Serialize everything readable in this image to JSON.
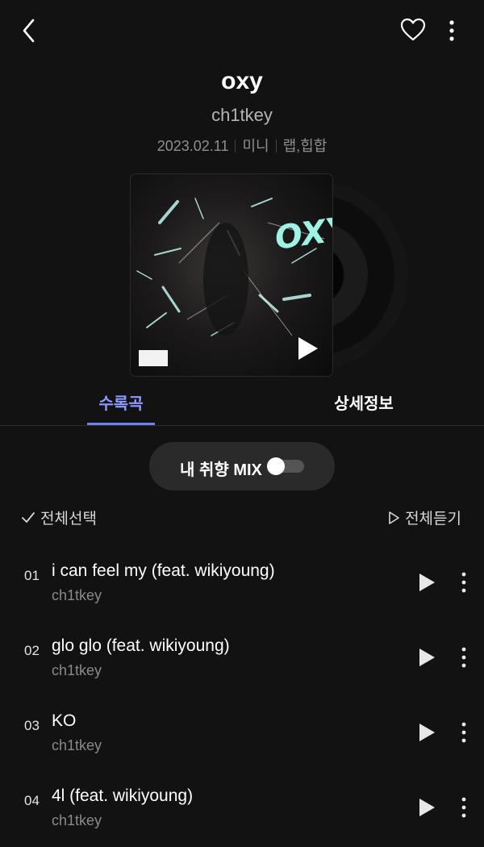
{
  "album": {
    "title": "oxy",
    "artist": "ch1tkey",
    "release_date": "2023.02.11",
    "type": "미니",
    "genre": "랩,힙합",
    "cover_text": "OXY",
    "advisory_label": "PARENTAL ADVISORY EXPLICIT CONTENT"
  },
  "tabs": [
    {
      "label": "수록곡",
      "active": true
    },
    {
      "label": "상세정보",
      "active": false
    }
  ],
  "mix": {
    "label": "내 취향 MIX",
    "enabled": false
  },
  "list_actions": {
    "select_all": "전체선택",
    "play_all": "전체듣기"
  },
  "tracks": [
    {
      "no": "01",
      "title": "i can feel my (feat. wikiyoung)",
      "artist": "ch1tkey"
    },
    {
      "no": "02",
      "title": "glo glo (feat. wikiyoung)",
      "artist": "ch1tkey"
    },
    {
      "no": "03",
      "title": "KO",
      "artist": "ch1tkey"
    },
    {
      "no": "04",
      "title": "4l (feat. wikiyoung)",
      "artist": "ch1tkey"
    }
  ],
  "icons": {
    "back": "chevron-left-icon",
    "like": "heart-outline-icon",
    "more": "vertical-dots-icon",
    "play": "play-icon",
    "check": "check-icon",
    "play_outline": "play-outline-icon"
  },
  "colors": {
    "background": "#121212",
    "accent": "#8d9bff",
    "secondary_text": "#8a8a8a"
  }
}
